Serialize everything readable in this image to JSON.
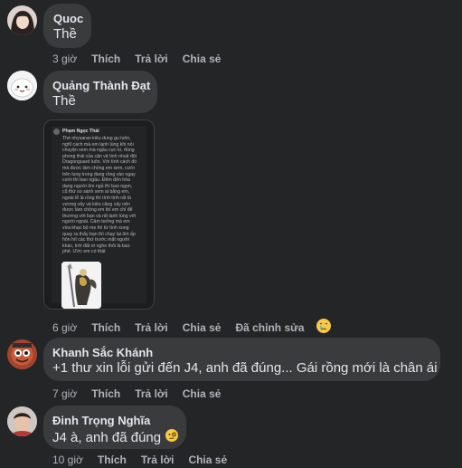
{
  "comments": [
    {
      "author": "Quoc",
      "text": "Thề",
      "time": "3 giờ",
      "like": "Thích",
      "reply": "Trả lời",
      "share": "Chia sẻ"
    },
    {
      "author": "Quảng Thành Đạt",
      "text": "Thề",
      "time": "6 giờ",
      "like": "Thích",
      "reply": "Trả lời",
      "share": "Chia sẻ",
      "edited": "Đã chỉnh sửa",
      "reaction_icon": "crying-face-emoji",
      "attachment": {
        "author": "Phạm Ngọc Thái",
        "text": "Thề nhysaran kiêu dung gu luôn, nghĩ cách mà em lạnh lùng khi nói chuyện xem mà ngầu cực kì, đúng phong thái của cận vệ tinh nhuệ đội Dragonguard luôn. Với tính cách đó mà được làm chồng em xem, cười trên lung trong đang rồng vào ngay cười thì bao ngầu. Đêm đến hòa dạng người ôm ngủ thì bao ngọn, cũ thứ so sánh xem ai bằng em, ngoài lễ là rồng thì tính tình rất là vương vãy và kiêu căng cây nên được làm chồng em thì em chỉ để thương với bạn và rất lạnh lùng với người ngoài. Cảm tưởng mà em vừa khạc bộ mẹ thì từ tính xong quay ra thấy bạn thì chạy lại ôm ấp hôn hít các thứ trước mặt người khác, trời đất ơi nghe thôi là bao phê. Ước em có thật"
      }
    },
    {
      "author": "Khanh Sắc Khánh",
      "text": "+1 thư xin lỗi gửi đến J4, anh đã đúng... Gái rồng mới là chân ái",
      "time": "7 giờ",
      "like": "Thích",
      "reply": "Trả lời",
      "share": "Chia sẻ"
    },
    {
      "author": "Đinh Trọng Nghĩa",
      "text": "J4 à, anh đã đúng",
      "text_emoji": "face-with-monocle-emoji",
      "time": "10 giờ",
      "like": "Thích",
      "reply": "Trả lời",
      "share": "Chia sẻ"
    }
  ],
  "colors": {
    "background": "#242526",
    "bubble": "#3a3b3c",
    "text": "#e4e6eb",
    "secondary_text": "#b0b3b8"
  }
}
